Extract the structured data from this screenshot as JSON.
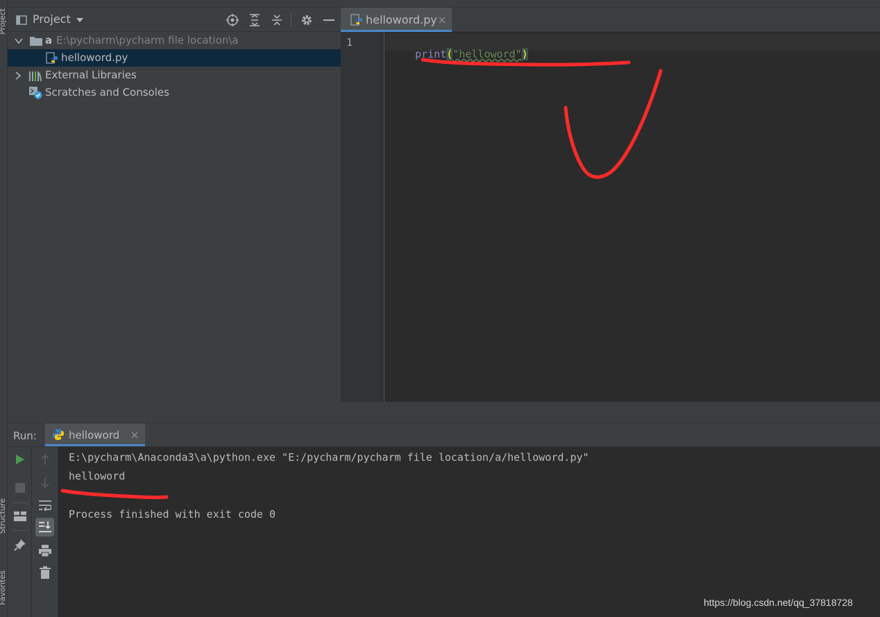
{
  "side_stripe": {
    "project_label": "Project",
    "structure_label": "Structure",
    "favorites_label": "Favorites"
  },
  "project_panel": {
    "title": "Project",
    "tree": {
      "root_name": "a",
      "root_path": "E:\\pycharm\\pycharm file location\\a",
      "file": "helloword.py",
      "external_libraries": "External Libraries",
      "scratches": "Scratches and Consoles"
    }
  },
  "editor": {
    "tab_label": "helloword.py",
    "line_number": "1",
    "code": {
      "func": "print",
      "open_paren": "(",
      "string": "\"helloword\"",
      "close_paren": ")"
    }
  },
  "run_panel": {
    "label": "Run:",
    "tab_label": "helloword",
    "console": [
      "E:\\pycharm\\Anaconda3\\a\\python.exe \"E:/pycharm/pycharm file location/a/helloword.py\"",
      "helloword",
      "",
      "Process finished with exit code 0"
    ]
  },
  "watermark": "https://blog.csdn.net/qq_37818728",
  "colors": {
    "accent_tab": "#4a88c7",
    "selection": "#0d293e",
    "keyword_print": "#8888c6",
    "string": "#6a8759",
    "bracket_highlight": "#ffef28",
    "annotation_red": "#ff2a2a",
    "run_green": "#499c54"
  }
}
